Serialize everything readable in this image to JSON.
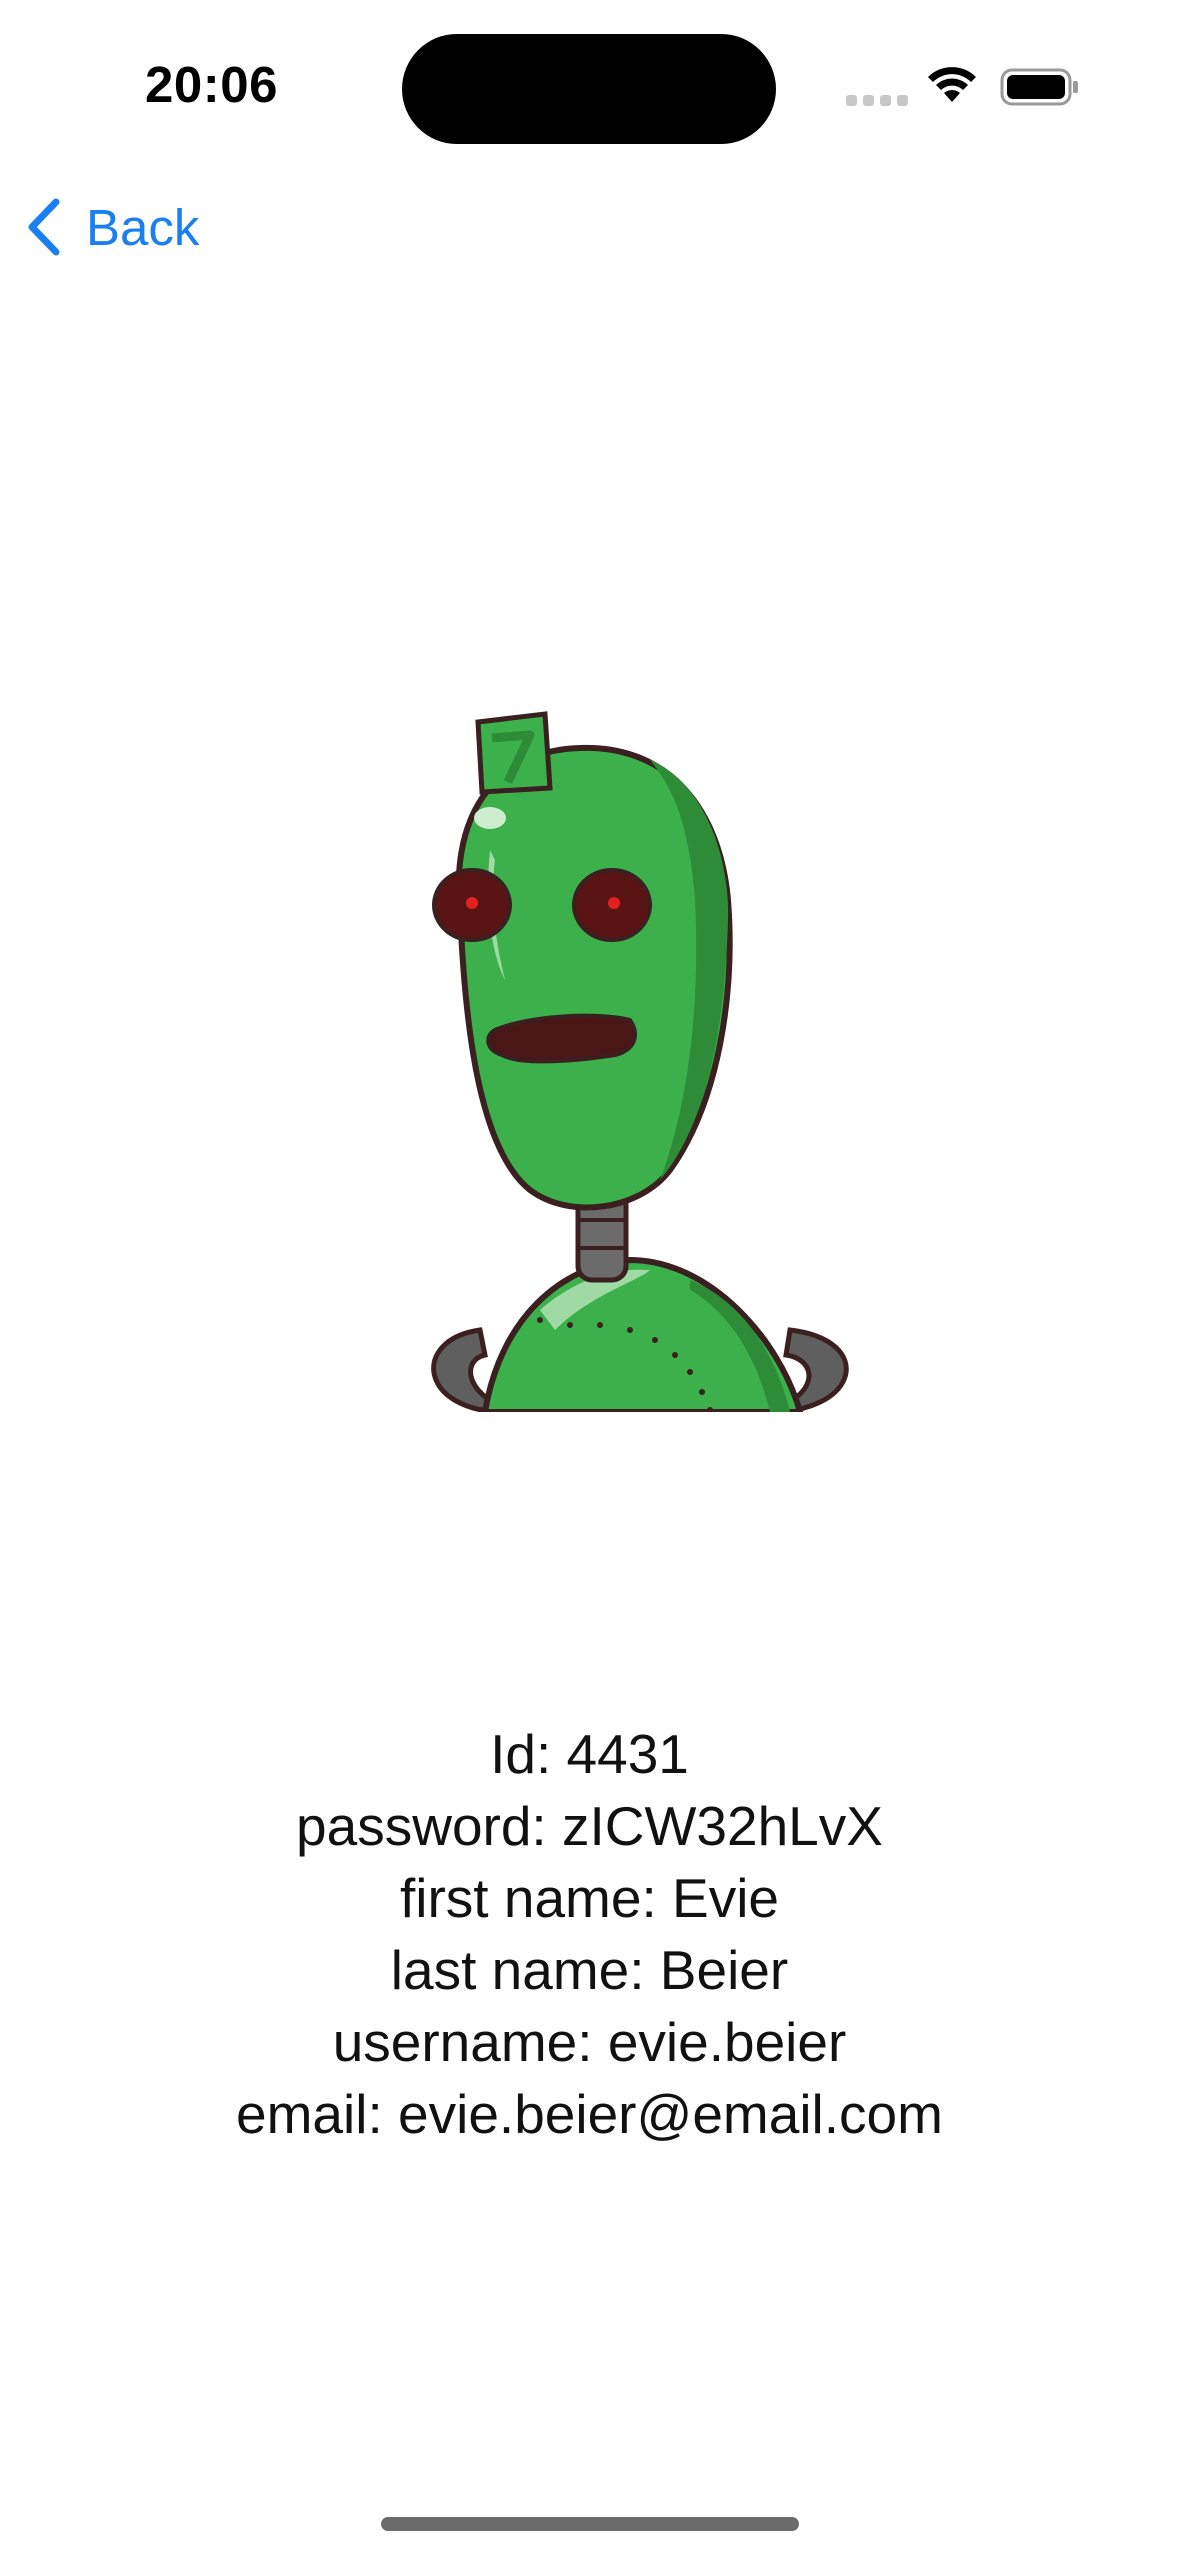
{
  "status_bar": {
    "time": "20:06",
    "icons": [
      "cellular-signal-icon",
      "wifi-icon",
      "battery-icon"
    ]
  },
  "nav": {
    "back_label": "Back",
    "back_icon": "chevron-left-icon",
    "accent_color": "#1a80f0"
  },
  "avatar": {
    "icon": "green-robot-avatar"
  },
  "user": {
    "id_line": "Id: 4431",
    "password_line": "password: zICW32hLvX",
    "first_name_line": "first name: Evie",
    "last_name_line": "last name: Beier",
    "username_line": "username: evie.beier",
    "email_line": "email: evie.beier@email.com"
  }
}
